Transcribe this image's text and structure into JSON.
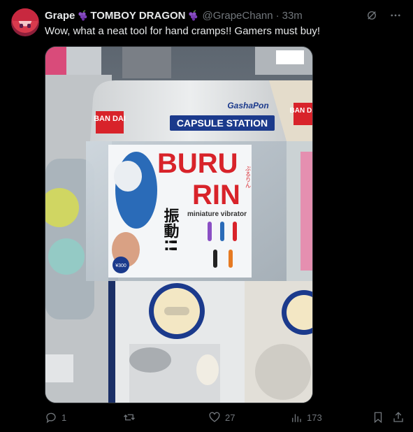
{
  "tweet": {
    "display_name": "Grape",
    "display_name_2": "TOMBOY DRAGON",
    "handle": "@GrapeChann",
    "separator": "·",
    "time": "33m",
    "text": "Wow, what a neat tool for hand cramps!! Gamers must buy!"
  },
  "photo": {
    "machine_brand_left": "BAN DAI",
    "machine_brand_right": "BAN DA",
    "capsule_station": "CAPSULE STATION",
    "gashapon_logo": "GashaPon",
    "product_title_1": "BURU",
    "product_title_2": "RIN",
    "product_jp": "振動!!",
    "product_subtitle": "miniature vibrator",
    "product_kana": "ぶるりん",
    "price": "¥300"
  },
  "actions": {
    "replies": "1",
    "reposts": "",
    "likes": "27",
    "views": "173"
  },
  "icons": [
    "grok-icon",
    "more-icon",
    "reply-icon",
    "repost-icon",
    "like-icon",
    "views-icon",
    "bookmark-icon",
    "share-icon"
  ],
  "colors": {
    "background": "#000000",
    "text": "#e7e9ea",
    "muted": "#71767b",
    "emoji": "#8a4fc4"
  }
}
